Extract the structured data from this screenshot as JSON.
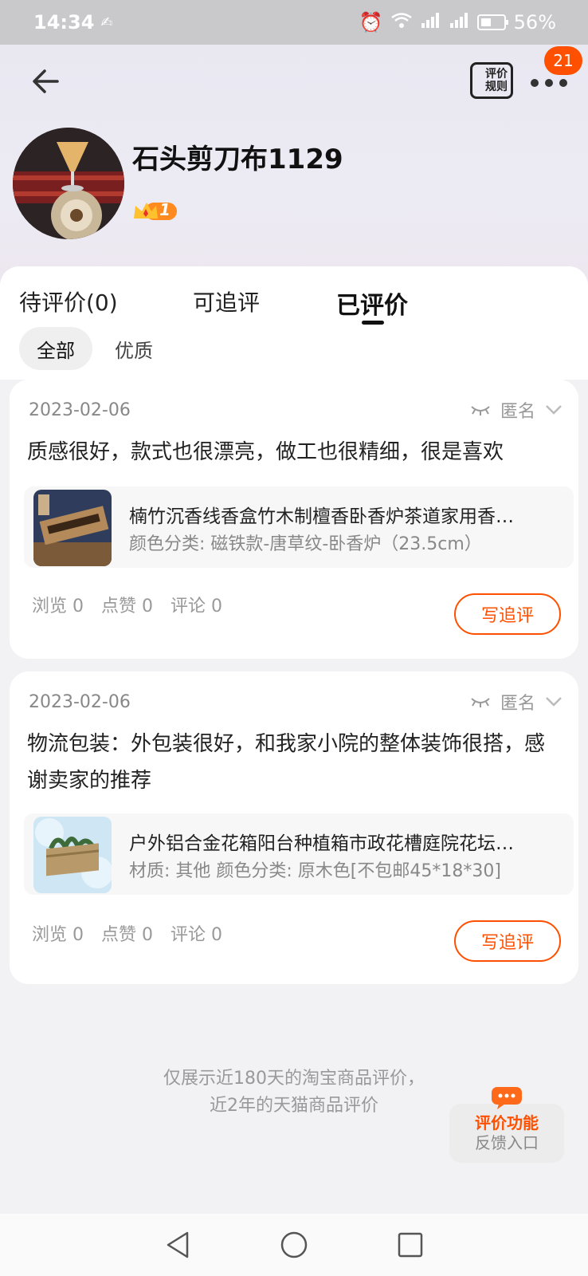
{
  "status_bar": {
    "time": "14:34",
    "battery": "56%"
  },
  "header": {
    "rules_label": "评价规则",
    "notification_count": "21"
  },
  "profile": {
    "username": "石头剪刀布1129",
    "level": "1"
  },
  "tabs": [
    {
      "label": "待评价(0)"
    },
    {
      "label": "可追评"
    },
    {
      "label": "已评价"
    }
  ],
  "filters": [
    {
      "label": "全部"
    },
    {
      "label": "优质"
    }
  ],
  "reviews": [
    {
      "date": "2023-02-06",
      "visibility": "匿名",
      "text": "质感很好，款式也很漂亮，做工也很精细，很是喜欢",
      "product_title": "楠竹沉香线香盒竹木制檀香卧香炉茶道家用香…",
      "product_spec": "颜色分类: 磁铁款-唐草纹-卧香炉（23.5cm）",
      "views": "浏览 0",
      "likes": "点赞 0",
      "comments": "评论 0",
      "action": "写追评"
    },
    {
      "date": "2023-02-06",
      "visibility": "匿名",
      "text": "物流包装：外包装很好，和我家小院的整体装饰很搭，感谢卖家的推荐",
      "product_title": "户外铝合金花箱阳台种植箱市政花槽庭院花坛…",
      "product_spec": "材质: 其他 颜色分类: 原木色[不包邮45*18*30]",
      "views": "浏览 0",
      "likes": "点赞 0",
      "comments": "评论 0",
      "action": "写追评"
    }
  ],
  "footnote": {
    "line1": "仅展示近180天的淘宝商品评价，",
    "line2": "近2年的天猫商品评价"
  },
  "feedback": {
    "line1": "评价功能",
    "line2": "反馈入口"
  },
  "colors": {
    "accent": "#ff5000"
  }
}
